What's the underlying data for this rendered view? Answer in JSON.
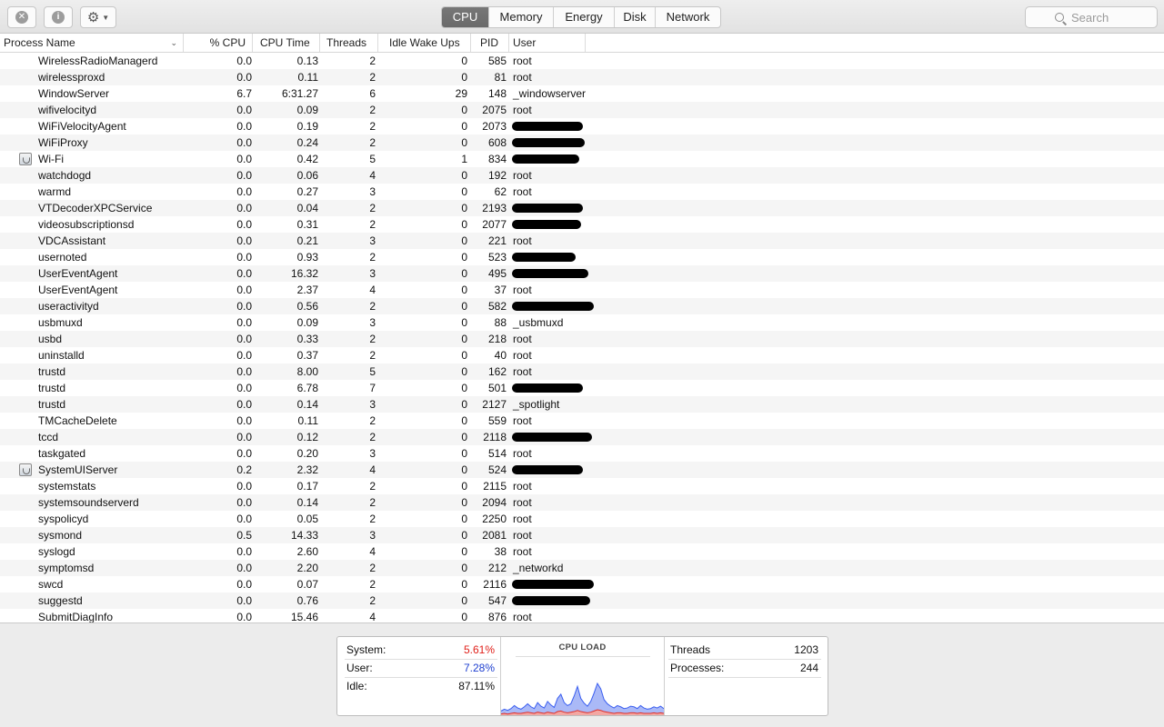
{
  "toolbar": {
    "stop_icon": "x-circle-icon",
    "info_icon": "info-icon",
    "gear_icon": "gear-icon",
    "tabs": [
      {
        "label": "CPU",
        "active": true
      },
      {
        "label": "Memory",
        "active": false
      },
      {
        "label": "Energy",
        "active": false
      },
      {
        "label": "Disk",
        "active": false
      },
      {
        "label": "Network",
        "active": false
      }
    ],
    "search_placeholder": "Search"
  },
  "table": {
    "columns": [
      "Process Name",
      "% CPU",
      "CPU Time",
      "Threads",
      "Idle Wake Ups",
      "PID",
      "User"
    ],
    "rows": [
      {
        "name": "WirelessRadioManagerd",
        "cpu": "0.0",
        "time": "0.13",
        "threads": "2",
        "idle": "0",
        "pid": "585",
        "user": "root",
        "icon": false,
        "redacted": false
      },
      {
        "name": "wirelessproxd",
        "cpu": "0.0",
        "time": "0.11",
        "threads": "2",
        "idle": "0",
        "pid": "81",
        "user": "root",
        "icon": false,
        "redacted": false
      },
      {
        "name": "WindowServer",
        "cpu": "6.7",
        "time": "6:31.27",
        "threads": "6",
        "idle": "29",
        "pid": "148",
        "user": "_windowserver",
        "icon": false,
        "redacted": false
      },
      {
        "name": "wifivelocityd",
        "cpu": "0.0",
        "time": "0.09",
        "threads": "2",
        "idle": "0",
        "pid": "2075",
        "user": "root",
        "icon": false,
        "redacted": false
      },
      {
        "name": "WiFiVelocityAgent",
        "cpu": "0.0",
        "time": "0.19",
        "threads": "2",
        "idle": "0",
        "pid": "2073",
        "user": "",
        "icon": false,
        "redacted": true
      },
      {
        "name": "WiFiProxy",
        "cpu": "0.0",
        "time": "0.24",
        "threads": "2",
        "idle": "0",
        "pid": "608",
        "user": "",
        "icon": false,
        "redacted": true
      },
      {
        "name": "Wi-Fi",
        "cpu": "0.0",
        "time": "0.42",
        "threads": "5",
        "idle": "1",
        "pid": "834",
        "user": "",
        "icon": true,
        "redacted": true
      },
      {
        "name": "watchdogd",
        "cpu": "0.0",
        "time": "0.06",
        "threads": "4",
        "idle": "0",
        "pid": "192",
        "user": "root",
        "icon": false,
        "redacted": false
      },
      {
        "name": "warmd",
        "cpu": "0.0",
        "time": "0.27",
        "threads": "3",
        "idle": "0",
        "pid": "62",
        "user": "root",
        "icon": false,
        "redacted": false
      },
      {
        "name": "VTDecoderXPCService",
        "cpu": "0.0",
        "time": "0.04",
        "threads": "2",
        "idle": "0",
        "pid": "2193",
        "user": "",
        "icon": false,
        "redacted": true
      },
      {
        "name": "videosubscriptionsd",
        "cpu": "0.0",
        "time": "0.31",
        "threads": "2",
        "idle": "0",
        "pid": "2077",
        "user": "",
        "icon": false,
        "redacted": true
      },
      {
        "name": "VDCAssistant",
        "cpu": "0.0",
        "time": "0.21",
        "threads": "3",
        "idle": "0",
        "pid": "221",
        "user": "root",
        "icon": false,
        "redacted": false
      },
      {
        "name": "usernoted",
        "cpu": "0.0",
        "time": "0.93",
        "threads": "2",
        "idle": "0",
        "pid": "523",
        "user": "",
        "icon": false,
        "redacted": true
      },
      {
        "name": "UserEventAgent",
        "cpu": "0.0",
        "time": "16.32",
        "threads": "3",
        "idle": "0",
        "pid": "495",
        "user": "",
        "icon": false,
        "redacted": true
      },
      {
        "name": "UserEventAgent",
        "cpu": "0.0",
        "time": "2.37",
        "threads": "4",
        "idle": "0",
        "pid": "37",
        "user": "root",
        "icon": false,
        "redacted": false
      },
      {
        "name": "useractivityd",
        "cpu": "0.0",
        "time": "0.56",
        "threads": "2",
        "idle": "0",
        "pid": "582",
        "user": "",
        "icon": false,
        "redacted": true
      },
      {
        "name": "usbmuxd",
        "cpu": "0.0",
        "time": "0.09",
        "threads": "3",
        "idle": "0",
        "pid": "88",
        "user": "_usbmuxd",
        "icon": false,
        "redacted": false
      },
      {
        "name": "usbd",
        "cpu": "0.0",
        "time": "0.33",
        "threads": "2",
        "idle": "0",
        "pid": "218",
        "user": "root",
        "icon": false,
        "redacted": false
      },
      {
        "name": "uninstalld",
        "cpu": "0.0",
        "time": "0.37",
        "threads": "2",
        "idle": "0",
        "pid": "40",
        "user": "root",
        "icon": false,
        "redacted": false
      },
      {
        "name": "trustd",
        "cpu": "0.0",
        "time": "8.00",
        "threads": "5",
        "idle": "0",
        "pid": "162",
        "user": "root",
        "icon": false,
        "redacted": false
      },
      {
        "name": "trustd",
        "cpu": "0.0",
        "time": "6.78",
        "threads": "7",
        "idle": "0",
        "pid": "501",
        "user": "",
        "icon": false,
        "redacted": true
      },
      {
        "name": "trustd",
        "cpu": "0.0",
        "time": "0.14",
        "threads": "3",
        "idle": "0",
        "pid": "2127",
        "user": "_spotlight",
        "icon": false,
        "redacted": false
      },
      {
        "name": "TMCacheDelete",
        "cpu": "0.0",
        "time": "0.11",
        "threads": "2",
        "idle": "0",
        "pid": "559",
        "user": "root",
        "icon": false,
        "redacted": false
      },
      {
        "name": "tccd",
        "cpu": "0.0",
        "time": "0.12",
        "threads": "2",
        "idle": "0",
        "pid": "2118",
        "user": "",
        "icon": false,
        "redacted": true
      },
      {
        "name": "taskgated",
        "cpu": "0.0",
        "time": "0.20",
        "threads": "3",
        "idle": "0",
        "pid": "514",
        "user": "root",
        "icon": false,
        "redacted": false
      },
      {
        "name": "SystemUIServer",
        "cpu": "0.2",
        "time": "2.32",
        "threads": "4",
        "idle": "0",
        "pid": "524",
        "user": "",
        "icon": true,
        "redacted": true
      },
      {
        "name": "systemstats",
        "cpu": "0.0",
        "time": "0.17",
        "threads": "2",
        "idle": "0",
        "pid": "2115",
        "user": "root",
        "icon": false,
        "redacted": false
      },
      {
        "name": "systemsoundserverd",
        "cpu": "0.0",
        "time": "0.14",
        "threads": "2",
        "idle": "0",
        "pid": "2094",
        "user": "root",
        "icon": false,
        "redacted": false
      },
      {
        "name": "syspolicyd",
        "cpu": "0.0",
        "time": "0.05",
        "threads": "2",
        "idle": "0",
        "pid": "2250",
        "user": "root",
        "icon": false,
        "redacted": false
      },
      {
        "name": "sysmond",
        "cpu": "0.5",
        "time": "14.33",
        "threads": "3",
        "idle": "0",
        "pid": "2081",
        "user": "root",
        "icon": false,
        "redacted": false
      },
      {
        "name": "syslogd",
        "cpu": "0.0",
        "time": "2.60",
        "threads": "4",
        "idle": "0",
        "pid": "38",
        "user": "root",
        "icon": false,
        "redacted": false
      },
      {
        "name": "symptomsd",
        "cpu": "0.0",
        "time": "2.20",
        "threads": "2",
        "idle": "0",
        "pid": "212",
        "user": "_networkd",
        "icon": false,
        "redacted": false
      },
      {
        "name": "swcd",
        "cpu": "0.0",
        "time": "0.07",
        "threads": "2",
        "idle": "0",
        "pid": "2116",
        "user": "",
        "icon": false,
        "redacted": true
      },
      {
        "name": "suggestd",
        "cpu": "0.0",
        "time": "0.76",
        "threads": "2",
        "idle": "0",
        "pid": "547",
        "user": "",
        "icon": false,
        "redacted": true
      },
      {
        "name": "SubmitDiagInfo",
        "cpu": "0.0",
        "time": "15.46",
        "threads": "4",
        "idle": "0",
        "pid": "876",
        "user": "root",
        "icon": false,
        "redacted": false
      }
    ]
  },
  "footer": {
    "stats": [
      {
        "label": "System:",
        "value": "5.61%",
        "color": "#e0201a"
      },
      {
        "label": "User:",
        "value": "7.28%",
        "color": "#1e3fd0"
      },
      {
        "label": "Idle:",
        "value": "87.11%",
        "color": "#111111"
      }
    ],
    "graph_title": "CPU LOAD",
    "counts": [
      {
        "label": "Threads",
        "value": "1203"
      },
      {
        "label": "Processes:",
        "value": "244"
      }
    ],
    "graph_colors": {
      "user": "#3a5ef0",
      "user_fill": "#aab9f7",
      "system": "#e0302a",
      "system_fill": "#f2a7a3"
    },
    "chart_data": {
      "type": "area",
      "series": [
        {
          "name": "User",
          "values": [
            5,
            7,
            6,
            8,
            12,
            9,
            7,
            10,
            14,
            10,
            8,
            16,
            11,
            9,
            18,
            13,
            10,
            22,
            28,
            16,
            12,
            14,
            26,
            40,
            22,
            15,
            11,
            18,
            30,
            44,
            36,
            20,
            14,
            11,
            9,
            12,
            10,
            8,
            9,
            11,
            10,
            8,
            12,
            9,
            7,
            8,
            10,
            9,
            11,
            8
          ]
        },
        {
          "name": "System",
          "values": [
            2,
            3,
            2,
            3,
            4,
            3,
            3,
            4,
            5,
            4,
            3,
            5,
            4,
            3,
            5,
            4,
            3,
            6,
            7,
            5,
            4,
            5,
            6,
            8,
            6,
            5,
            4,
            5,
            7,
            9,
            8,
            6,
            5,
            4,
            3,
            4,
            4,
            3,
            3,
            4,
            4,
            3,
            4,
            3,
            3,
            3,
            4,
            3,
            4,
            3
          ]
        }
      ],
      "ylim": [
        0,
        100
      ]
    }
  }
}
